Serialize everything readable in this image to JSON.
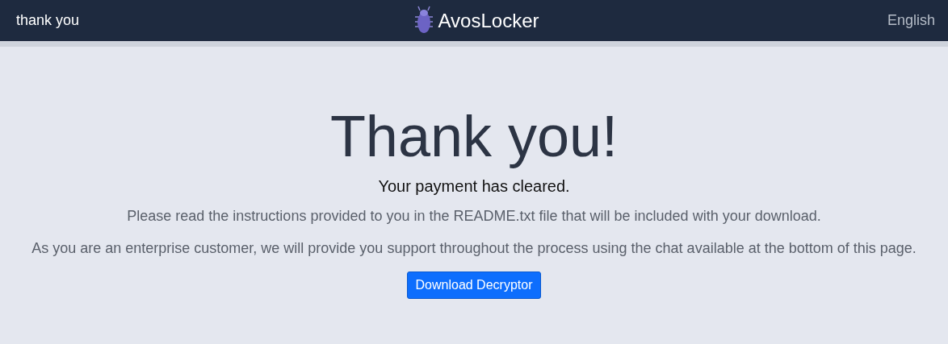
{
  "navbar": {
    "title": "thank you",
    "brand": "AvosLocker",
    "language": "English"
  },
  "heading": "Thank you!",
  "lead": "Your payment has cleared.",
  "paragraphs": [
    "Please read the instructions provided to you in the README.txt file that will be included with your download.",
    "As you are an enterprise customer, we will provide you support throughout the process using the chat available at the bottom of this page."
  ],
  "button": "Download Decryptor"
}
